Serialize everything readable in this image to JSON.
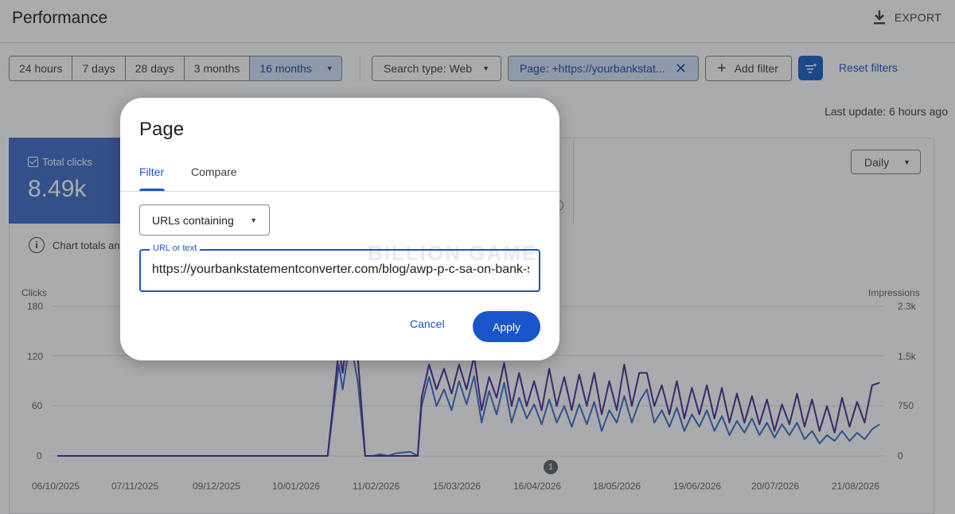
{
  "header": {
    "title": "Performance",
    "export_label": "EXPORT"
  },
  "toolbar": {
    "date_ranges": [
      "24 hours",
      "7 days",
      "28 days",
      "3 months",
      "16 months"
    ],
    "selected_range": "16 months",
    "search_type": "Search type: Web",
    "page_filter": "Page: +https://yourbankstat...",
    "add_filter": "Add filter",
    "reset_filters": "Reset filters"
  },
  "last_update": "Last update: 6 hours ago",
  "metric": {
    "label": "Total clicks",
    "value": "8.49k",
    "checked": true
  },
  "chart_controls": {
    "granularity": "Daily"
  },
  "totals_note": "Chart totals an",
  "chart_data": {
    "type": "line",
    "left_axis": {
      "title": "Clicks",
      "ticks": [
        "180",
        "120",
        "60",
        "0"
      ],
      "range": [
        0,
        180
      ]
    },
    "right_axis": {
      "title": "Impressions",
      "ticks": [
        "2.3k",
        "1.5k",
        "750",
        "0"
      ],
      "range": [
        0,
        2300
      ]
    },
    "x_ticks": [
      "06/10/2025",
      "07/11/2025",
      "09/12/2025",
      "10/01/2026",
      "11/02/2026",
      "15/03/2026",
      "16/04/2026",
      "18/05/2026",
      "19/06/2026",
      "20/07/2026",
      "21/08/2026"
    ],
    "series": [
      {
        "color": "#3a6fd0",
        "segments": [
          [
            0,
            0
          ],
          [
            50,
            0
          ],
          [
            70,
            0
          ],
          [
            72,
            0
          ],
          [
            75,
            110
          ],
          [
            76,
            80
          ],
          [
            78,
            140
          ],
          [
            80,
            90
          ],
          [
            82,
            0
          ],
          [
            84,
            0
          ],
          [
            86,
            2
          ],
          [
            88,
            0
          ],
          [
            90,
            3
          ],
          [
            92,
            4
          ],
          [
            94,
            5
          ],
          [
            96,
            0
          ],
          [
            97,
            60
          ],
          [
            99,
            95
          ],
          [
            101,
            60
          ],
          [
            103,
            80
          ],
          [
            105,
            55
          ],
          [
            107,
            90
          ],
          [
            109,
            62
          ],
          [
            111,
            96
          ],
          [
            113,
            40
          ],
          [
            115,
            78
          ],
          [
            117,
            50
          ],
          [
            119,
            88
          ],
          [
            121,
            40
          ],
          [
            123,
            70
          ],
          [
            125,
            45
          ],
          [
            127,
            62
          ],
          [
            129,
            38
          ],
          [
            131,
            68
          ],
          [
            133,
            40
          ],
          [
            135,
            60
          ],
          [
            137,
            35
          ],
          [
            139,
            62
          ],
          [
            141,
            38
          ],
          [
            143,
            65
          ],
          [
            145,
            30
          ],
          [
            147,
            55
          ],
          [
            149,
            40
          ],
          [
            151,
            72
          ],
          [
            153,
            40
          ],
          [
            155,
            65
          ],
          [
            157,
            80
          ],
          [
            159,
            40
          ],
          [
            161,
            55
          ],
          [
            163,
            35
          ],
          [
            165,
            58
          ],
          [
            167,
            30
          ],
          [
            169,
            50
          ],
          [
            171,
            35
          ],
          [
            173,
            55
          ],
          [
            175,
            30
          ],
          [
            177,
            48
          ],
          [
            179,
            25
          ],
          [
            181,
            42
          ],
          [
            183,
            28
          ],
          [
            185,
            45
          ],
          [
            187,
            25
          ],
          [
            189,
            40
          ],
          [
            191,
            22
          ],
          [
            193,
            38
          ],
          [
            195,
            25
          ],
          [
            197,
            40
          ],
          [
            199,
            20
          ],
          [
            201,
            30
          ],
          [
            203,
            15
          ],
          [
            205,
            25
          ],
          [
            207,
            18
          ],
          [
            209,
            30
          ],
          [
            211,
            18
          ],
          [
            213,
            28
          ],
          [
            215,
            20
          ],
          [
            217,
            32
          ],
          [
            219,
            38
          ]
        ]
      },
      {
        "color": "#4c2a9e",
        "segments": [
          [
            0,
            0
          ],
          [
            72,
            0
          ],
          [
            75,
            130
          ],
          [
            76,
            100
          ],
          [
            78,
            175
          ],
          [
            80,
            120
          ],
          [
            82,
            0
          ],
          [
            84,
            0
          ],
          [
            96,
            0
          ],
          [
            97,
            70
          ],
          [
            99,
            110
          ],
          [
            101,
            80
          ],
          [
            103,
            105
          ],
          [
            105,
            75
          ],
          [
            107,
            110
          ],
          [
            109,
            80
          ],
          [
            111,
            120
          ],
          [
            113,
            55
          ],
          [
            115,
            95
          ],
          [
            117,
            70
          ],
          [
            119,
            112
          ],
          [
            121,
            60
          ],
          [
            123,
            100
          ],
          [
            125,
            60
          ],
          [
            127,
            90
          ],
          [
            129,
            55
          ],
          [
            131,
            105
          ],
          [
            133,
            60
          ],
          [
            135,
            95
          ],
          [
            137,
            55
          ],
          [
            139,
            98
          ],
          [
            141,
            60
          ],
          [
            143,
            100
          ],
          [
            145,
            50
          ],
          [
            147,
            90
          ],
          [
            149,
            55
          ],
          [
            151,
            110
          ],
          [
            153,
            60
          ],
          [
            155,
            100
          ],
          [
            157,
            100
          ],
          [
            159,
            60
          ],
          [
            161,
            85
          ],
          [
            163,
            50
          ],
          [
            165,
            90
          ],
          [
            167,
            45
          ],
          [
            169,
            82
          ],
          [
            171,
            50
          ],
          [
            173,
            85
          ],
          [
            175,
            45
          ],
          [
            177,
            82
          ],
          [
            179,
            40
          ],
          [
            181,
            75
          ],
          [
            183,
            40
          ],
          [
            185,
            72
          ],
          [
            187,
            38
          ],
          [
            189,
            68
          ],
          [
            191,
            30
          ],
          [
            193,
            62
          ],
          [
            195,
            38
          ],
          [
            197,
            75
          ],
          [
            199,
            35
          ],
          [
            201,
            68
          ],
          [
            203,
            30
          ],
          [
            205,
            60
          ],
          [
            207,
            28
          ],
          [
            209,
            70
          ],
          [
            211,
            35
          ],
          [
            213,
            65
          ],
          [
            215,
            40
          ],
          [
            217,
            85
          ],
          [
            219,
            88
          ]
        ]
      }
    ],
    "x_span": 220
  },
  "annotation": "1",
  "dialog": {
    "title": "Page",
    "tabs": [
      "Filter",
      "Compare"
    ],
    "active_tab": "Filter",
    "match_type": "URLs containing",
    "url_label": "URL or text",
    "url_value": "https://yourbankstatementconverter.com/blog/awp-p-c-sa-on-bank-statement/",
    "cancel": "Cancel",
    "apply": "Apply"
  },
  "watermark": "BILLION GAME"
}
